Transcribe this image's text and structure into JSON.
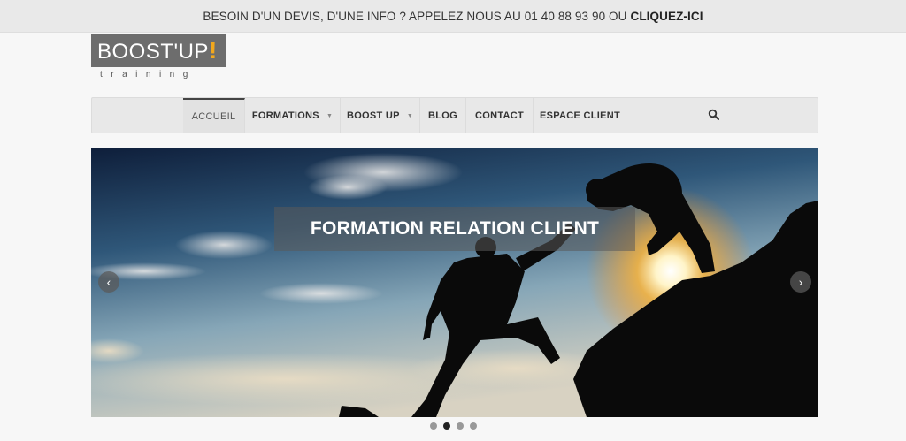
{
  "topbar": {
    "message": "BESOIN D'UN DEVIS, D'UNE INFO ? APPELEZ NOUS AU 01 40 88 93 90 OU",
    "cta": "CLIQUEZ-ICI"
  },
  "logo": {
    "brand": "BOOST'UP",
    "mark": "!",
    "tagline": "training"
  },
  "nav": {
    "items": [
      {
        "label": "ACCUEIL",
        "active": true
      },
      {
        "label": "FORMATIONS",
        "dropdown": true
      },
      {
        "label": "BOOST UP",
        "dropdown": true
      },
      {
        "label": "BLOG"
      },
      {
        "label": "CONTACT"
      },
      {
        "label": "ESPACE CLIENT"
      }
    ],
    "search_icon": "search-icon"
  },
  "slider": {
    "caption": "FORMATION RELATION CLIENT",
    "prev_icon": "chevron-left-icon",
    "next_icon": "chevron-right-icon",
    "slide_count": 4,
    "active_slide": 2
  },
  "colors": {
    "logo_bg": "#6d6d6d",
    "logo_accent": "#f2a81d",
    "topbar_bg": "#e9e9e9",
    "nav_bg": "#e8e8e8"
  }
}
